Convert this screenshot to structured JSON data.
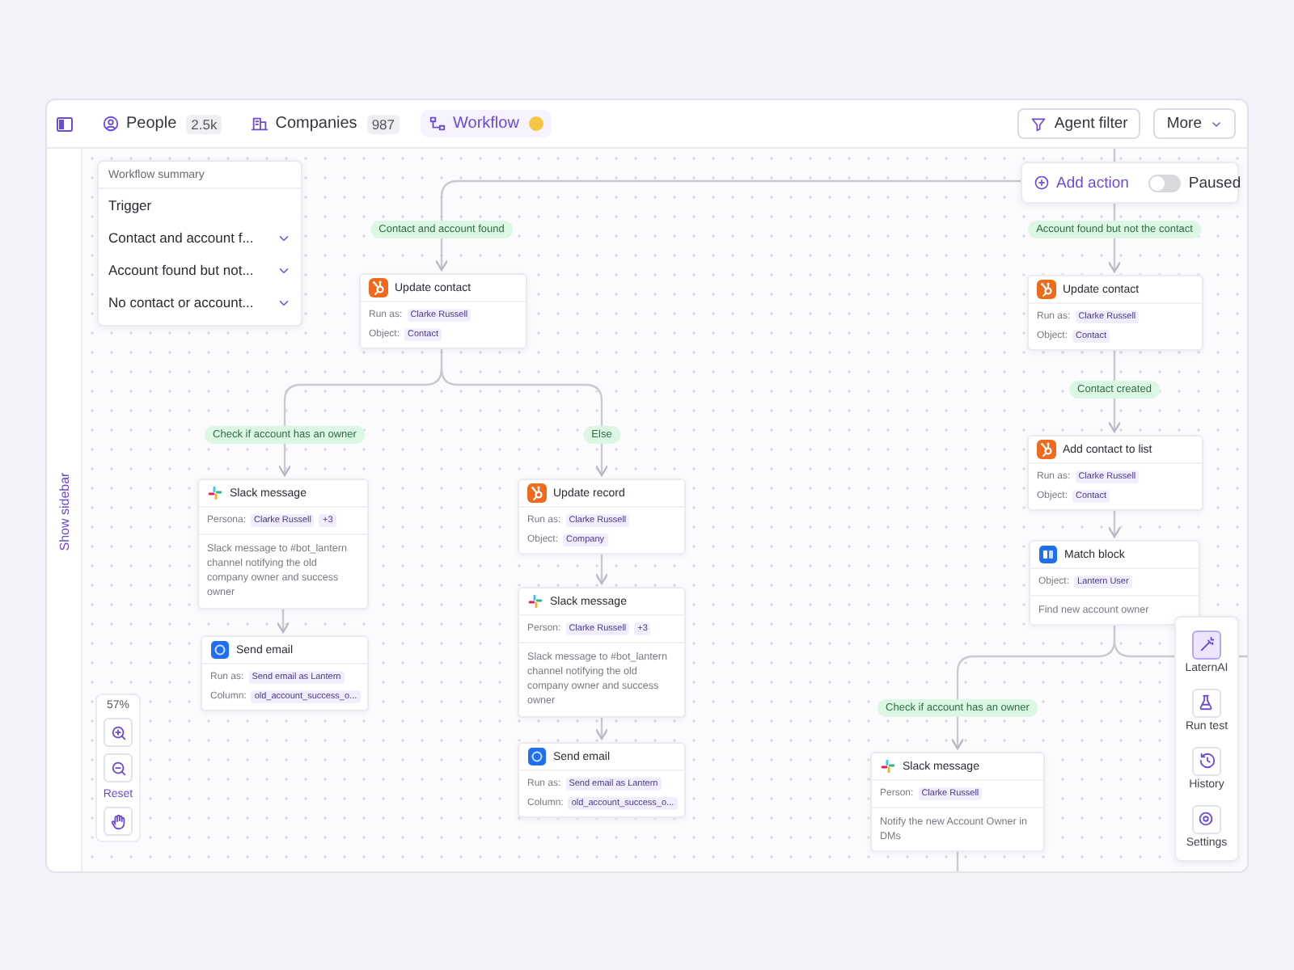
{
  "nav": {
    "items": [
      {
        "label": "People",
        "count": "2.5k",
        "selected": false,
        "dot": false
      },
      {
        "label": "Companies",
        "count": "987",
        "selected": false,
        "dot": false
      },
      {
        "label": "Workflow",
        "selected": true,
        "dot": true
      }
    ]
  },
  "actions": [
    {
      "kind": "filter",
      "label": "Agent filter"
    },
    {
      "kind": "dropdown",
      "label": "More"
    }
  ],
  "sidebar_toggle": {
    "label": "Show sidebar"
  },
  "summary": {
    "title": "Workflow summary",
    "items": [
      {
        "label": "Trigger",
        "kind": "plain"
      },
      {
        "label": "Contact and account f...",
        "kind": "collapsible"
      },
      {
        "label": "Account found but not...",
        "kind": "collapsible"
      },
      {
        "label": "No contact or account...",
        "kind": "collapsible"
      }
    ]
  },
  "add_action": {
    "label": "Add action"
  },
  "pause_toggle": {
    "label": "Paused",
    "on": false
  },
  "branch_labels": [
    "Contact and account found",
    "Account found but not the contact",
    "Check if account has an owner",
    "Else",
    "Contact created",
    "Check if account has an owner"
  ],
  "nodes": [
    {
      "kind": "hubspot",
      "title": "Update contact",
      "fields": [
        {
          "label": "Run as:",
          "values": [
            "Clarke Russell"
          ]
        },
        {
          "label": "Object:",
          "values": [
            "Contact"
          ]
        }
      ]
    },
    {
      "kind": "slack",
      "title": "Slack message",
      "fields": [
        {
          "label": "Persona:",
          "values": [
            "Clarke Russell",
            "+3"
          ]
        }
      ],
      "description": "Slack message to #bot_lantern channel notifying the old company owner and success owner"
    },
    {
      "kind": "email",
      "title": "Send email",
      "fields": [
        {
          "label": "Run as:",
          "values": [
            "Send email as Lantern"
          ]
        },
        {
          "label": "Column:",
          "values": [
            "old_account_success_o..."
          ]
        }
      ]
    },
    {
      "kind": "hubspot",
      "title": "Update record",
      "fields": [
        {
          "label": "Run as:",
          "values": [
            "Clarke Russell"
          ]
        },
        {
          "label": "Object:",
          "values": [
            "Company"
          ]
        }
      ]
    },
    {
      "kind": "slack",
      "title": "Slack message",
      "fields": [
        {
          "label": "Person:",
          "values": [
            "Clarke Russell",
            "+3"
          ]
        }
      ],
      "description": "Slack message to #bot_lantern channel notifying the old company owner and success owner"
    },
    {
      "kind": "email",
      "title": "Send email",
      "fields": [
        {
          "label": "Run as:",
          "values": [
            "Send email as Lantern"
          ]
        },
        {
          "label": "Column:",
          "values": [
            "old_account_success_o..."
          ]
        }
      ]
    },
    {
      "kind": "hubspot",
      "title": "Update contact",
      "fields": [
        {
          "label": "Run as:",
          "values": [
            "Clarke Russell"
          ]
        },
        {
          "label": "Object:",
          "values": [
            "Contact"
          ]
        }
      ]
    },
    {
      "kind": "hubspot",
      "title": "Add contact to list",
      "fields": [
        {
          "label": "Run as:",
          "values": [
            "Clarke Russell"
          ]
        },
        {
          "label": "Object:",
          "values": [
            "Contact"
          ]
        }
      ]
    },
    {
      "kind": "match",
      "title": "Match block",
      "fields": [
        {
          "label": "Object:",
          "values": [
            "Lantern User"
          ]
        }
      ],
      "description": "Find new account owner"
    },
    {
      "kind": "slack",
      "title": "Slack message",
      "fields": [
        {
          "label": "Person:",
          "values": [
            "Clarke Russell"
          ]
        }
      ],
      "description": "Notify the new Account Owner in DMs"
    }
  ],
  "zoom": {
    "reading": "57%",
    "reset": "Reset"
  },
  "tools": [
    {
      "kind": "ai",
      "label": "LaternAI",
      "selected": true
    },
    {
      "kind": "test",
      "label": "Run test",
      "selected": false
    },
    {
      "kind": "history",
      "label": "History",
      "selected": false
    },
    {
      "kind": "settings",
      "label": "Settings",
      "selected": false
    }
  ]
}
